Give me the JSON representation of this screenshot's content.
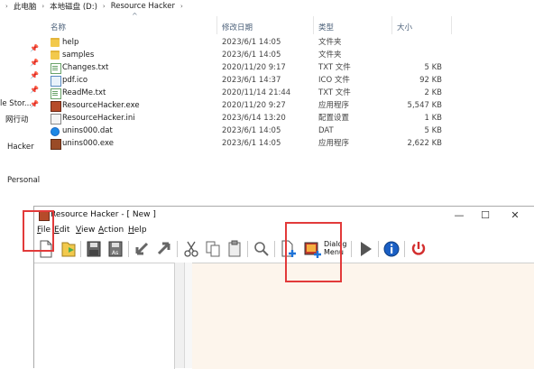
{
  "explorer": {
    "breadcrumb": [
      "此电脑",
      "本地磁盘 (D:)",
      "Resource Hacker"
    ],
    "columns": {
      "name": "名称",
      "date": "修改日期",
      "type": "类型",
      "size": "大小"
    },
    "left_labels": [
      "le Stor...",
      "网行动",
      "Hacker",
      "Personal"
    ],
    "files": [
      {
        "name": "help",
        "date": "2023/6/1 14:05",
        "type": "文件夹",
        "size": "",
        "icon": "folder-icon"
      },
      {
        "name": "samples",
        "date": "2023/6/1 14:05",
        "type": "文件夹",
        "size": "",
        "icon": "folder-icon"
      },
      {
        "name": "Changes.txt",
        "date": "2020/11/20 9:17",
        "type": "TXT 文件",
        "size": "5 KB",
        "icon": "text-file-icon"
      },
      {
        "name": "pdf.ico",
        "date": "2023/6/1 14:37",
        "type": "ICO 文件",
        "size": "92 KB",
        "icon": "ico-file-icon"
      },
      {
        "name": "ReadMe.txt",
        "date": "2020/11/14 21:44",
        "type": "TXT 文件",
        "size": "2 KB",
        "icon": "text-file-icon"
      },
      {
        "name": "ResourceHacker.exe",
        "date": "2020/11/20 9:27",
        "type": "应用程序",
        "size": "5,547 KB",
        "icon": "resource-hacker-icon"
      },
      {
        "name": "ResourceHacker.ini",
        "date": "2023/6/14 13:20",
        "type": "配置设置",
        "size": "1 KB",
        "icon": "ini-file-icon"
      },
      {
        "name": "unins000.dat",
        "date": "2023/6/1 14:05",
        "type": "DAT",
        "size": "5 KB",
        "icon": "dat-file-icon"
      },
      {
        "name": "unins000.exe",
        "date": "2023/6/1 14:05",
        "type": "应用程序",
        "size": "2,622 KB",
        "icon": "uninstaller-icon"
      }
    ]
  },
  "window": {
    "title": "Resource Hacker - [ New ]",
    "menu": [
      "File",
      "Edit",
      "View",
      "Action",
      "Help"
    ],
    "menu_mnemonics": [
      "F",
      "E",
      "V",
      "A",
      "H"
    ],
    "toolbar": {
      "dialog_menu_label_1": "Dialog",
      "dialog_menu_label_2": "Menu",
      "items": [
        "new-file",
        "open-file",
        "save",
        "save-as",
        "back",
        "forward",
        "cut",
        "copy",
        "paste",
        "find",
        "add-resource",
        "dialog-menu",
        "run",
        "about",
        "exit"
      ]
    }
  },
  "highlight_color": "#e23a3a",
  "editor_bg": "#fdf5ec"
}
